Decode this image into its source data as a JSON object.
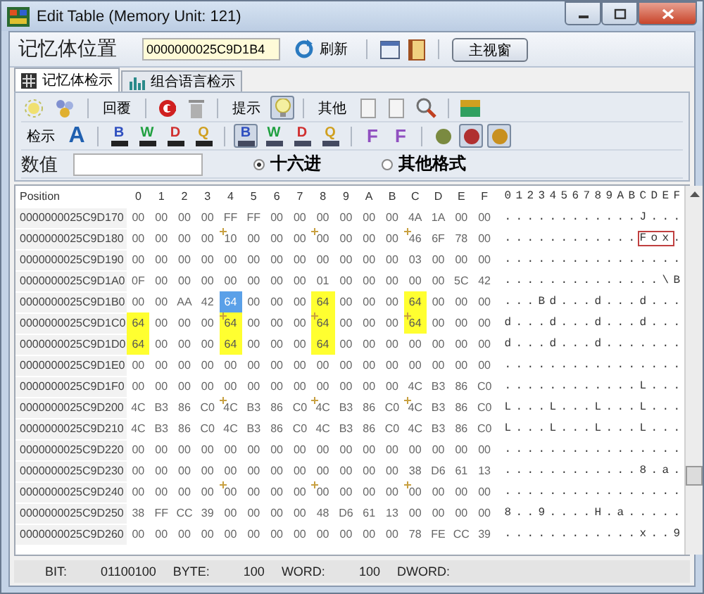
{
  "window": {
    "title": "Edit Table (Memory Unit: 121)"
  },
  "address_bar": {
    "label": "记忆体位置",
    "value": "0000000025C9D1B4",
    "refresh": "刷新",
    "main_button": "主视窗"
  },
  "tabs": [
    {
      "label": "记忆体检示",
      "selected": true
    },
    {
      "label": "组合语言检示",
      "selected": false
    }
  ],
  "toolbar_1": [
    {
      "kind": "sun"
    },
    {
      "kind": "cluster"
    },
    {
      "kind": "sep"
    },
    {
      "kind": "label",
      "text": "回覆"
    },
    {
      "kind": "sep"
    },
    {
      "kind": "undo"
    },
    {
      "kind": "trash"
    },
    {
      "kind": "sep"
    },
    {
      "kind": "label",
      "text": "提示"
    },
    {
      "kind": "bulb",
      "pressed": true
    },
    {
      "kind": "sep"
    },
    {
      "kind": "label",
      "text": "其他"
    },
    {
      "kind": "page"
    },
    {
      "kind": "page"
    },
    {
      "kind": "magnifier"
    },
    {
      "kind": "sep"
    },
    {
      "kind": "chest"
    }
  ],
  "toolbar_2": [
    {
      "kind": "label",
      "text": "检示"
    },
    {
      "kind": "glyph",
      "text": "A"
    },
    {
      "kind": "sep"
    },
    {
      "kind": "dec",
      "text": "B",
      "color": "#3050c0",
      "pressed": false
    },
    {
      "kind": "dec",
      "text": "W",
      "color": "#20a040",
      "pressed": false
    },
    {
      "kind": "dec",
      "text": "D",
      "color": "#d03030",
      "pressed": false
    },
    {
      "kind": "dec",
      "text": "Q",
      "color": "#d0a020",
      "pressed": false
    },
    {
      "kind": "sep"
    },
    {
      "kind": "hex",
      "text": "B",
      "color": "#3050c0",
      "pressed": true
    },
    {
      "kind": "hex",
      "text": "W",
      "color": "#20a040",
      "pressed": false
    },
    {
      "kind": "hex",
      "text": "D",
      "color": "#d03030",
      "pressed": false
    },
    {
      "kind": "hex",
      "text": "Q",
      "color": "#d0a020",
      "pressed": false
    },
    {
      "kind": "sep"
    },
    {
      "kind": "frame",
      "text": "F",
      "pressed": false
    },
    {
      "kind": "frame",
      "text": "F",
      "pressed": false
    },
    {
      "kind": "sep"
    },
    {
      "kind": "round",
      "color": "#7a8a40",
      "pressed": false
    },
    {
      "kind": "round",
      "color": "#b03030",
      "pressed": true
    },
    {
      "kind": "round",
      "color": "#c89020",
      "pressed": true
    }
  ],
  "value_row": {
    "label": "数值",
    "options": [
      {
        "label": "十六进",
        "selected": true
      },
      {
        "label": "其他格式",
        "selected": false
      }
    ]
  },
  "table": {
    "position_header": "Position",
    "hex_headers": [
      "0",
      "1",
      "2",
      "3",
      "4",
      "5",
      "6",
      "7",
      "8",
      "9",
      "A",
      "B",
      "C",
      "D",
      "E",
      "F"
    ],
    "ascii_header": "0123456789ABCDEF",
    "rows": [
      {
        "position": "0000000025C9D170",
        "bytes": [
          "00",
          "00",
          "00",
          "00",
          "FF",
          "FF",
          "00",
          "00",
          "00",
          "00",
          "00",
          "00",
          "4A",
          "1A",
          "00",
          "00"
        ],
        "highlighted": [
          false,
          false,
          false,
          false,
          false,
          false,
          false,
          false,
          false,
          false,
          false,
          false,
          false,
          false,
          false,
          false
        ],
        "selected": [
          false,
          false,
          false,
          false,
          false,
          false,
          false,
          false,
          false,
          false,
          false,
          false,
          false,
          false,
          false,
          false
        ],
        "ascii": [
          {
            "text": "............J...",
            "boxed": false
          }
        ]
      },
      {
        "position": "0000000025C9D180",
        "bytes": [
          "00",
          "00",
          "00",
          "00",
          "10",
          "00",
          "00",
          "00",
          "00",
          "00",
          "00",
          "00",
          "46",
          "6F",
          "78",
          "00"
        ],
        "highlighted": [
          false,
          false,
          false,
          false,
          false,
          false,
          false,
          false,
          false,
          false,
          false,
          false,
          false,
          false,
          false,
          false
        ],
        "selected": [
          false,
          false,
          false,
          false,
          false,
          false,
          false,
          false,
          false,
          false,
          false,
          false,
          false,
          false,
          false,
          false
        ],
        "ascii": [
          {
            "text": "............",
            "boxed": false
          },
          {
            "text": "Fox",
            "boxed": true
          },
          {
            "text": ".",
            "boxed": false
          }
        ]
      },
      {
        "position": "0000000025C9D190",
        "bytes": [
          "00",
          "00",
          "00",
          "00",
          "00",
          "00",
          "00",
          "00",
          "00",
          "00",
          "00",
          "00",
          "03",
          "00",
          "00",
          "00"
        ],
        "highlighted": [
          false,
          false,
          false,
          false,
          false,
          false,
          false,
          false,
          false,
          false,
          false,
          false,
          false,
          false,
          false,
          false
        ],
        "selected": [
          false,
          false,
          false,
          false,
          false,
          false,
          false,
          false,
          false,
          false,
          false,
          false,
          false,
          false,
          false,
          false
        ],
        "ascii": [
          {
            "text": "................",
            "boxed": false
          }
        ]
      },
      {
        "position": "0000000025C9D1A0",
        "bytes": [
          "0F",
          "00",
          "00",
          "00",
          "00",
          "00",
          "00",
          "00",
          "01",
          "00",
          "00",
          "00",
          "00",
          "00",
          "5C",
          "42"
        ],
        "highlighted": [
          false,
          false,
          false,
          false,
          false,
          false,
          false,
          false,
          false,
          false,
          false,
          false,
          false,
          false,
          false,
          false
        ],
        "selected": [
          false,
          false,
          false,
          false,
          false,
          false,
          false,
          false,
          false,
          false,
          false,
          false,
          false,
          false,
          false,
          false
        ],
        "ascii": [
          {
            "text": "..............\\B",
            "boxed": false
          }
        ]
      },
      {
        "position": "0000000025C9D1B0",
        "bytes": [
          "00",
          "00",
          "AA",
          "42",
          "64",
          "00",
          "00",
          "00",
          "64",
          "00",
          "00",
          "00",
          "64",
          "00",
          "00",
          "00"
        ],
        "highlighted": [
          false,
          false,
          false,
          false,
          false,
          false,
          false,
          false,
          true,
          false,
          false,
          false,
          true,
          false,
          false,
          false
        ],
        "selected": [
          false,
          false,
          false,
          false,
          true,
          false,
          false,
          false,
          false,
          false,
          false,
          false,
          false,
          false,
          false,
          false
        ],
        "ascii": [
          {
            "text": "...Bd...d...d...",
            "boxed": false
          }
        ]
      },
      {
        "position": "0000000025C9D1C0",
        "bytes": [
          "64",
          "00",
          "00",
          "00",
          "64",
          "00",
          "00",
          "00",
          "64",
          "00",
          "00",
          "00",
          "64",
          "00",
          "00",
          "00"
        ],
        "highlighted": [
          true,
          false,
          false,
          false,
          true,
          false,
          false,
          false,
          true,
          false,
          false,
          false,
          true,
          false,
          false,
          false
        ],
        "selected": [
          false,
          false,
          false,
          false,
          false,
          false,
          false,
          false,
          false,
          false,
          false,
          false,
          false,
          false,
          false,
          false
        ],
        "ascii": [
          {
            "text": "d...d...d...d...",
            "boxed": false
          }
        ]
      },
      {
        "position": "0000000025C9D1D0",
        "bytes": [
          "64",
          "00",
          "00",
          "00",
          "64",
          "00",
          "00",
          "00",
          "64",
          "00",
          "00",
          "00",
          "00",
          "00",
          "00",
          "00"
        ],
        "highlighted": [
          true,
          false,
          false,
          false,
          true,
          false,
          false,
          false,
          true,
          false,
          false,
          false,
          false,
          false,
          false,
          false
        ],
        "selected": [
          false,
          false,
          false,
          false,
          false,
          false,
          false,
          false,
          false,
          false,
          false,
          false,
          false,
          false,
          false,
          false
        ],
        "ascii": [
          {
            "text": "d...d...d.......",
            "boxed": false
          }
        ]
      },
      {
        "position": "0000000025C9D1E0",
        "bytes": [
          "00",
          "00",
          "00",
          "00",
          "00",
          "00",
          "00",
          "00",
          "00",
          "00",
          "00",
          "00",
          "00",
          "00",
          "00",
          "00"
        ],
        "highlighted": [
          false,
          false,
          false,
          false,
          false,
          false,
          false,
          false,
          false,
          false,
          false,
          false,
          false,
          false,
          false,
          false
        ],
        "selected": [
          false,
          false,
          false,
          false,
          false,
          false,
          false,
          false,
          false,
          false,
          false,
          false,
          false,
          false,
          false,
          false
        ],
        "ascii": [
          {
            "text": "................",
            "boxed": false
          }
        ]
      },
      {
        "position": "0000000025C9D1F0",
        "bytes": [
          "00",
          "00",
          "00",
          "00",
          "00",
          "00",
          "00",
          "00",
          "00",
          "00",
          "00",
          "00",
          "4C",
          "B3",
          "86",
          "C0"
        ],
        "highlighted": [
          false,
          false,
          false,
          false,
          false,
          false,
          false,
          false,
          false,
          false,
          false,
          false,
          false,
          false,
          false,
          false
        ],
        "selected": [
          false,
          false,
          false,
          false,
          false,
          false,
          false,
          false,
          false,
          false,
          false,
          false,
          false,
          false,
          false,
          false
        ],
        "ascii": [
          {
            "text": "............L...",
            "boxed": false
          }
        ]
      },
      {
        "position": "0000000025C9D200",
        "bytes": [
          "4C",
          "B3",
          "86",
          "C0",
          "4C",
          "B3",
          "86",
          "C0",
          "4C",
          "B3",
          "86",
          "C0",
          "4C",
          "B3",
          "86",
          "C0"
        ],
        "highlighted": [
          false,
          false,
          false,
          false,
          false,
          false,
          false,
          false,
          false,
          false,
          false,
          false,
          false,
          false,
          false,
          false
        ],
        "selected": [
          false,
          false,
          false,
          false,
          false,
          false,
          false,
          false,
          false,
          false,
          false,
          false,
          false,
          false,
          false,
          false
        ],
        "ascii": [
          {
            "text": "L...L...L...L...",
            "boxed": false
          }
        ]
      },
      {
        "position": "0000000025C9D210",
        "bytes": [
          "4C",
          "B3",
          "86",
          "C0",
          "4C",
          "B3",
          "86",
          "C0",
          "4C",
          "B3",
          "86",
          "C0",
          "4C",
          "B3",
          "86",
          "C0"
        ],
        "highlighted": [
          false,
          false,
          false,
          false,
          false,
          false,
          false,
          false,
          false,
          false,
          false,
          false,
          false,
          false,
          false,
          false
        ],
        "selected": [
          false,
          false,
          false,
          false,
          false,
          false,
          false,
          false,
          false,
          false,
          false,
          false,
          false,
          false,
          false,
          false
        ],
        "ascii": [
          {
            "text": "L...L...L...L...",
            "boxed": false
          }
        ]
      },
      {
        "position": "0000000025C9D220",
        "bytes": [
          "00",
          "00",
          "00",
          "00",
          "00",
          "00",
          "00",
          "00",
          "00",
          "00",
          "00",
          "00",
          "00",
          "00",
          "00",
          "00"
        ],
        "highlighted": [
          false,
          false,
          false,
          false,
          false,
          false,
          false,
          false,
          false,
          false,
          false,
          false,
          false,
          false,
          false,
          false
        ],
        "selected": [
          false,
          false,
          false,
          false,
          false,
          false,
          false,
          false,
          false,
          false,
          false,
          false,
          false,
          false,
          false,
          false
        ],
        "ascii": [
          {
            "text": "................",
            "boxed": false
          }
        ]
      },
      {
        "position": "0000000025C9D230",
        "bytes": [
          "00",
          "00",
          "00",
          "00",
          "00",
          "00",
          "00",
          "00",
          "00",
          "00",
          "00",
          "00",
          "38",
          "D6",
          "61",
          "13"
        ],
        "highlighted": [
          false,
          false,
          false,
          false,
          false,
          false,
          false,
          false,
          false,
          false,
          false,
          false,
          false,
          false,
          false,
          false
        ],
        "selected": [
          false,
          false,
          false,
          false,
          false,
          false,
          false,
          false,
          false,
          false,
          false,
          false,
          false,
          false,
          false,
          false
        ],
        "ascii": [
          {
            "text": "............8.a.",
            "boxed": false
          }
        ]
      },
      {
        "position": "0000000025C9D240",
        "bytes": [
          "00",
          "00",
          "00",
          "00",
          "00",
          "00",
          "00",
          "00",
          "00",
          "00",
          "00",
          "00",
          "00",
          "00",
          "00",
          "00"
        ],
        "highlighted": [
          false,
          false,
          false,
          false,
          false,
          false,
          false,
          false,
          false,
          false,
          false,
          false,
          false,
          false,
          false,
          false
        ],
        "selected": [
          false,
          false,
          false,
          false,
          false,
          false,
          false,
          false,
          false,
          false,
          false,
          false,
          false,
          false,
          false,
          false
        ],
        "ascii": [
          {
            "text": "................",
            "boxed": false
          }
        ]
      },
      {
        "position": "0000000025C9D250",
        "bytes": [
          "38",
          "FF",
          "CC",
          "39",
          "00",
          "00",
          "00",
          "00",
          "48",
          "D6",
          "61",
          "13",
          "00",
          "00",
          "00",
          "00"
        ],
        "highlighted": [
          false,
          false,
          false,
          false,
          false,
          false,
          false,
          false,
          false,
          false,
          false,
          false,
          false,
          false,
          false,
          false
        ],
        "selected": [
          false,
          false,
          false,
          false,
          false,
          false,
          false,
          false,
          false,
          false,
          false,
          false,
          false,
          false,
          false,
          false
        ],
        "ascii": [
          {
            "text": "8..9....H.a.....",
            "boxed": false
          }
        ]
      },
      {
        "position": "0000000025C9D260",
        "bytes": [
          "00",
          "00",
          "00",
          "00",
          "00",
          "00",
          "00",
          "00",
          "00",
          "00",
          "00",
          "00",
          "78",
          "FE",
          "CC",
          "39"
        ],
        "highlighted": [
          false,
          false,
          false,
          false,
          false,
          false,
          false,
          false,
          false,
          false,
          false,
          false,
          false,
          false,
          false,
          false
        ],
        "selected": [
          false,
          false,
          false,
          false,
          false,
          false,
          false,
          false,
          false,
          false,
          false,
          false,
          false,
          false,
          false,
          false
        ],
        "ascii": [
          {
            "text": "............x..9",
            "boxed": false
          }
        ]
      }
    ]
  },
  "status_bar": [
    {
      "label": "BIT:",
      "value": "01100100"
    },
    {
      "label": "BYTE:",
      "value": "100"
    },
    {
      "label": "WORD:",
      "value": "100"
    },
    {
      "label": "DWORD:"
    }
  ]
}
